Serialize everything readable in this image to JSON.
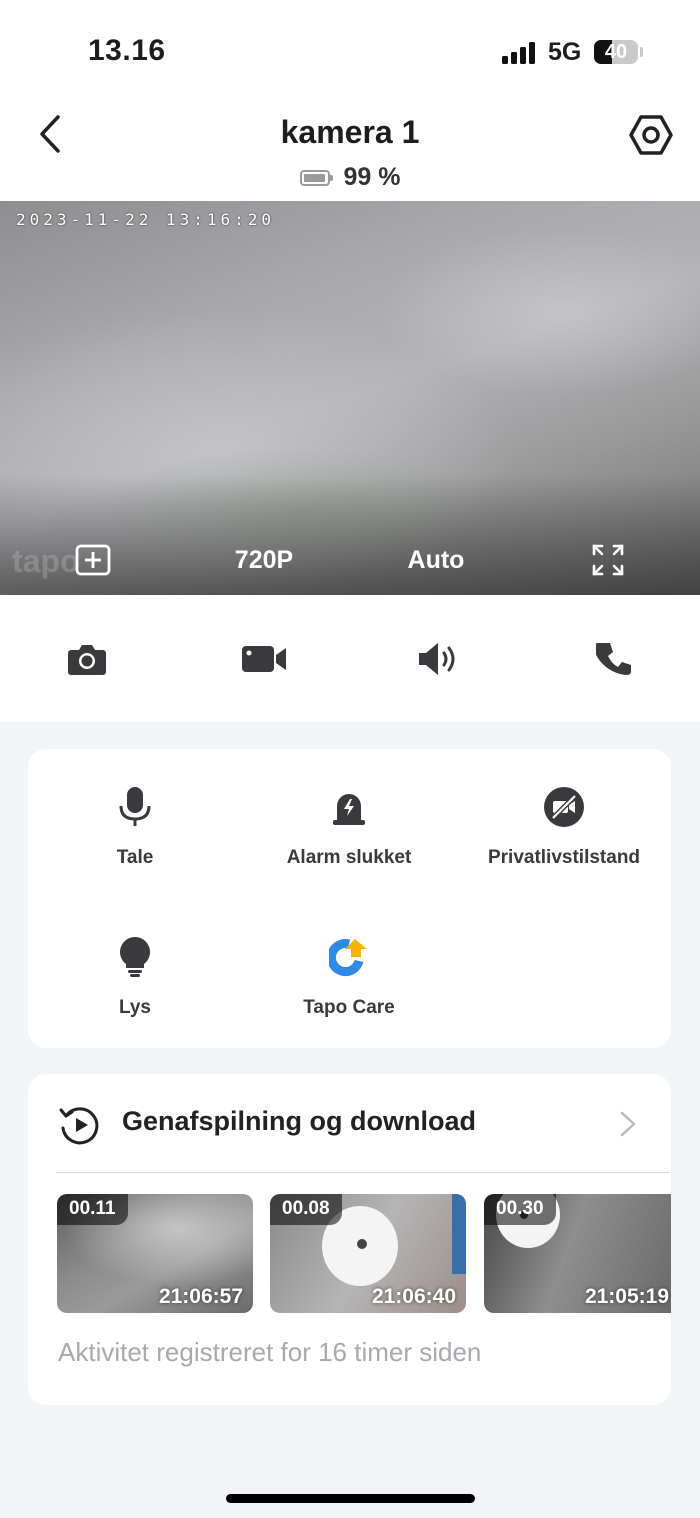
{
  "status_bar": {
    "time": "13.16",
    "network": "5G",
    "battery_level": "40",
    "battery_fraction": 0.4
  },
  "header": {
    "title": "kamera 1",
    "battery_text": "99 %",
    "battery_fraction": 0.99
  },
  "video": {
    "timestamp": "2023-11-22 13:16:20",
    "watermark": "tapo",
    "resolution": "720P",
    "mode": "Auto"
  },
  "quick_actions": [
    "camera-icon",
    "video-record-icon",
    "speaker-icon",
    "phone-icon"
  ],
  "features": [
    {
      "label": "Tale",
      "icon": "microphone-icon"
    },
    {
      "label": "Alarm slukket",
      "icon": "alarm-siren-icon"
    },
    {
      "label": "Privatlivstilstand",
      "icon": "privacy-camera-off-icon"
    },
    {
      "label": "Lys",
      "icon": "lightbulb-icon"
    },
    {
      "label": "Tapo Care",
      "icon": "tapo-care-icon"
    }
  ],
  "playback": {
    "title": "Genafspilning og download",
    "clips": [
      {
        "duration": "00.11",
        "time": "21:06:57"
      },
      {
        "duration": "00.08",
        "time": "21:06:40"
      },
      {
        "duration": "00.30",
        "time": "21:05:19"
      }
    ],
    "activity_text": "Aktivitet registreret for 16 timer siden"
  },
  "colors": {
    "background": "#f3f4f8",
    "card": "#ffffff",
    "accent_blue": "#2f8ae6",
    "accent_yellow": "#f5b400"
  }
}
